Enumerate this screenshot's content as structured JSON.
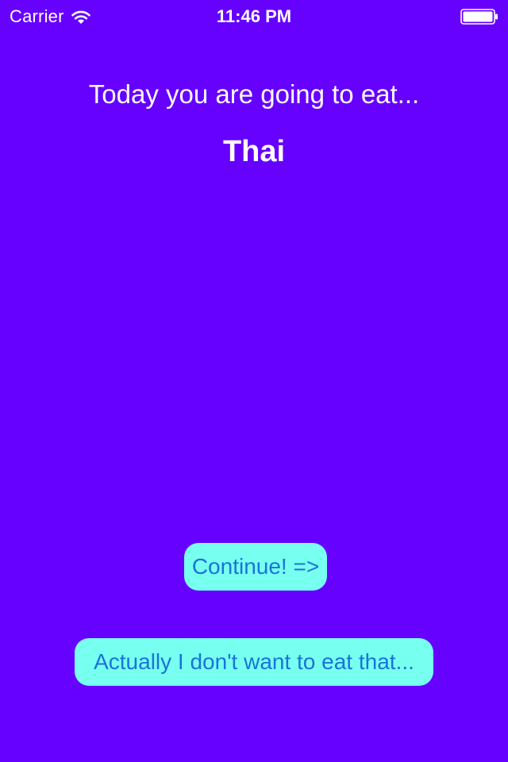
{
  "status_bar": {
    "carrier": "Carrier",
    "time": "11:46 PM",
    "wifi_icon": "wifi-icon",
    "battery_icon": "battery-icon"
  },
  "main": {
    "prompt": "Today you are going to eat...",
    "food": "Thai",
    "continue_label": "Continue! =>",
    "reject_label": "Actually I don't want to eat that..."
  },
  "colors": {
    "background": "#6600FF",
    "button_bg": "#77FFF0",
    "button_text": "#1A73D9",
    "text": "#FFFFFF"
  }
}
